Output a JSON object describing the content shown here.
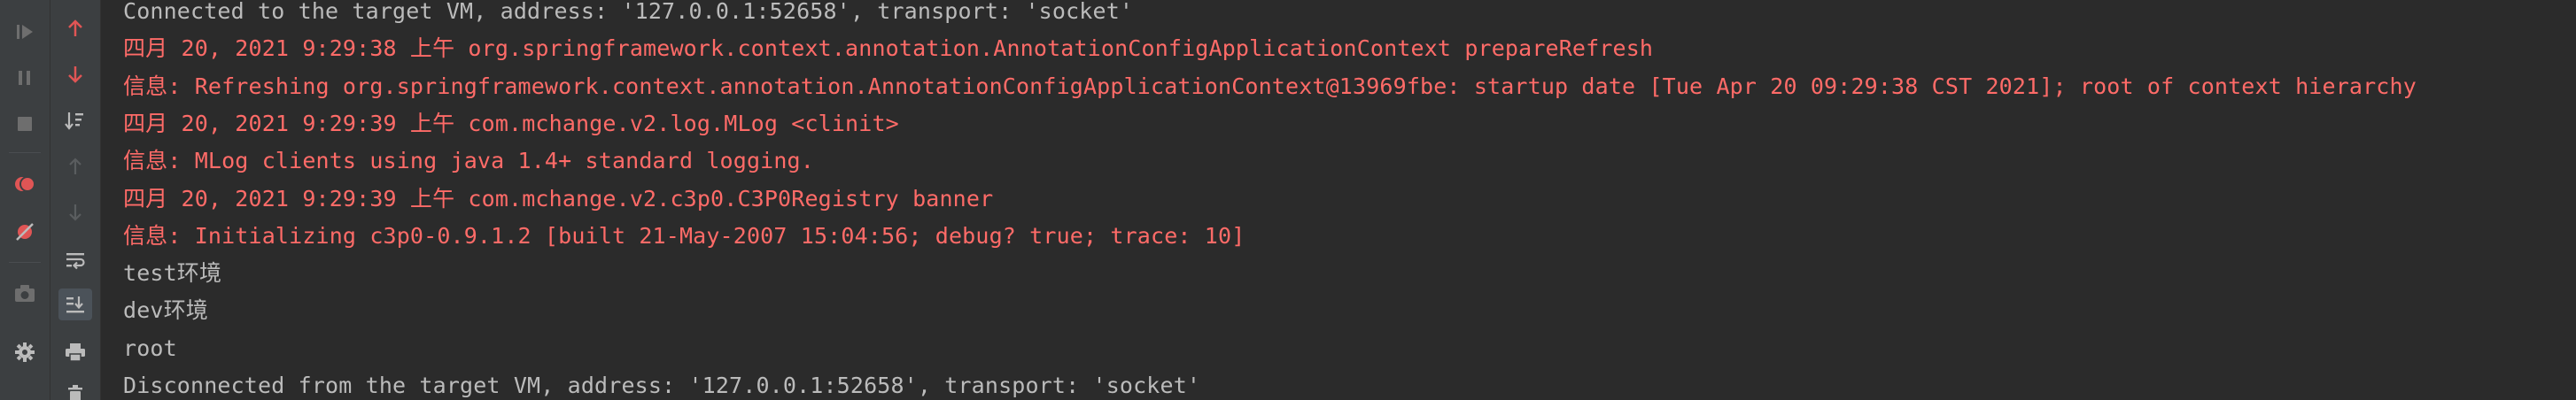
{
  "toolbar": {
    "buttons": [
      {
        "name": "resume-icon"
      },
      {
        "name": "pause-icon"
      },
      {
        "name": "stop-icon"
      },
      {
        "name": "view-breakpoints-icon"
      },
      {
        "name": "mute-breakpoints-icon"
      },
      {
        "name": "camera-icon"
      },
      {
        "name": "settings-icon"
      },
      {
        "name": "up-arrow-icon"
      },
      {
        "name": "down-arrow-icon"
      },
      {
        "name": "sort-icon"
      },
      {
        "name": "up-trace-icon"
      },
      {
        "name": "down-trace-icon"
      },
      {
        "name": "soft-wrap-icon"
      },
      {
        "name": "scroll-to-end-icon"
      },
      {
        "name": "print-icon"
      },
      {
        "name": "trash-icon"
      }
    ]
  },
  "console": {
    "lines": [
      {
        "text": "Connected to the target VM, address: '127.0.0.1:52658', transport: 'socket'",
        "kind": "normal"
      },
      {
        "text": "四月 20, 2021 9:29:38 上午 org.springframework.context.annotation.AnnotationConfigApplicationContext prepareRefresh",
        "kind": "error"
      },
      {
        "text": "信息: Refreshing org.springframework.context.annotation.AnnotationConfigApplicationContext@13969fbe: startup date [Tue Apr 20 09:29:38 CST 2021]; root of context hierarchy",
        "kind": "error"
      },
      {
        "text": "四月 20, 2021 9:29:39 上午 com.mchange.v2.log.MLog <clinit>",
        "kind": "error"
      },
      {
        "text": "信息: MLog clients using java 1.4+ standard logging.",
        "kind": "error"
      },
      {
        "text": "四月 20, 2021 9:29:39 上午 com.mchange.v2.c3p0.C3P0Registry banner",
        "kind": "error"
      },
      {
        "text": "信息: Initializing c3p0-0.9.1.2 [built 21-May-2007 15:04:56; debug? true; trace: 10]",
        "kind": "error"
      },
      {
        "text": "test环境",
        "kind": "normal"
      },
      {
        "text": "dev环境",
        "kind": "normal"
      },
      {
        "text": "root",
        "kind": "normal"
      },
      {
        "text": "Disconnected from the target VM, address: '127.0.0.1:52658', transport: 'socket'",
        "kind": "normal"
      }
    ]
  },
  "colors": {
    "background": "#2b2b2b",
    "toolbar": "#3c3f41",
    "normal_text": "#bbbbbb",
    "error_text": "#ff6b68",
    "accent_red": "#e05555"
  }
}
